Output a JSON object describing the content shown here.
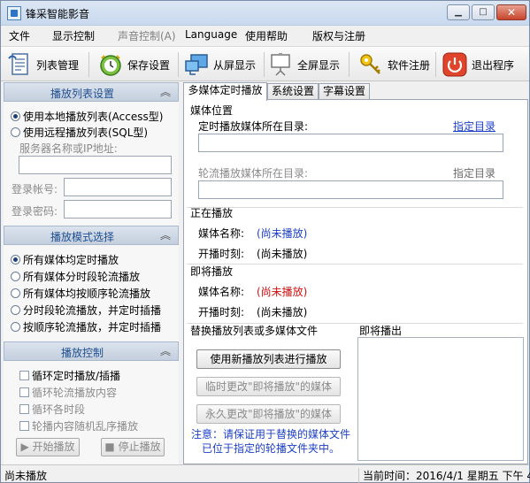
{
  "window": {
    "title": "锋采智能影音",
    "controls": {
      "minimize": "▁",
      "maximize": "□",
      "close": "✕"
    }
  },
  "menu": [
    {
      "label": "文件",
      "enabled": true
    },
    {
      "label": "显示控制",
      "enabled": true
    },
    {
      "label": "声音控制(A)",
      "enabled": false
    },
    {
      "label": "Language",
      "enabled": true
    },
    {
      "label": "使用帮助",
      "enabled": true
    },
    {
      "label": "版权与注册",
      "enabled": true
    }
  ],
  "toolbar": [
    {
      "label": "列表管理",
      "icon": "document-icon"
    },
    {
      "label": "保存设置",
      "icon": "clock-save-icon"
    },
    {
      "label": "从屏显示",
      "icon": "screen-icon"
    },
    {
      "label": "全屏显示",
      "icon": "projector-icon"
    },
    {
      "label": "软件注册",
      "icon": "key-icon"
    },
    {
      "label": "退出程序",
      "icon": "power-icon"
    }
  ],
  "left": {
    "playlist": {
      "header": "播放列表设置",
      "options": [
        "使用本地播放列表(Access型)",
        "使用远程播放列表(SQL型)"
      ],
      "selected": 0,
      "server_label": "服务器名称或IP地址:",
      "server_value": "",
      "account_label": "登录帐号:",
      "account_value": "",
      "password_label": "登录密码:",
      "password_value": ""
    },
    "mode": {
      "header": "播放模式选择",
      "options": [
        "所有媒体均定时播放",
        "所有媒体分时段轮流播放",
        "所有媒体均按顺序轮流播放",
        "分时段轮流播放，并定时插播",
        "按顺序轮流播放，并定时插播"
      ],
      "selected": 0
    },
    "control": {
      "header": "播放控制",
      "checks": [
        "循环定时播放/插播",
        "循环轮流播放内容",
        "循环各时段",
        "轮播内容随机乱序播放"
      ],
      "start_label": "开始播放",
      "stop_label": "停止播放"
    }
  },
  "tabs": [
    "多媒体定时播放",
    "系统设置",
    "字幕设置"
  ],
  "main": {
    "media_location": "媒体位置",
    "timed_dir_label": "定时播放媒体所在目录:",
    "timed_dir_link": "指定目录",
    "timed_dir_value": "",
    "rotate_dir_label": "轮流播放媒体所在目录:",
    "rotate_dir_link": "指定目录",
    "rotate_dir_value": "",
    "now_playing": "正在播放",
    "media_name_label": "媒体名称:",
    "now_media_name": "(尚未播放)",
    "start_time_label": "开播时刻:",
    "now_start_time": "(尚未播放)",
    "next_playing": "即将播放",
    "next_media_name_label": "媒体名称:",
    "next_media_name": "(尚未播放)",
    "next_start_time_label": "开播时刻:",
    "next_start_time": "(尚未播放)",
    "replace_title": "替换播放列表或多媒体文件",
    "btn_new_list": "使用新播放列表进行播放",
    "btn_temp_change": "临时更改\"即将播放\"的媒体",
    "btn_perm_change": "永久更改\"即将播放\"的媒体",
    "note": "注意：请保证用于替换的媒体文件已位于指定的轮播文件夹中。",
    "upcoming_title": "即将播出"
  },
  "status": {
    "left": "尚未播放",
    "right": "当前时间：2016/4/1 星期五 下午 4"
  }
}
